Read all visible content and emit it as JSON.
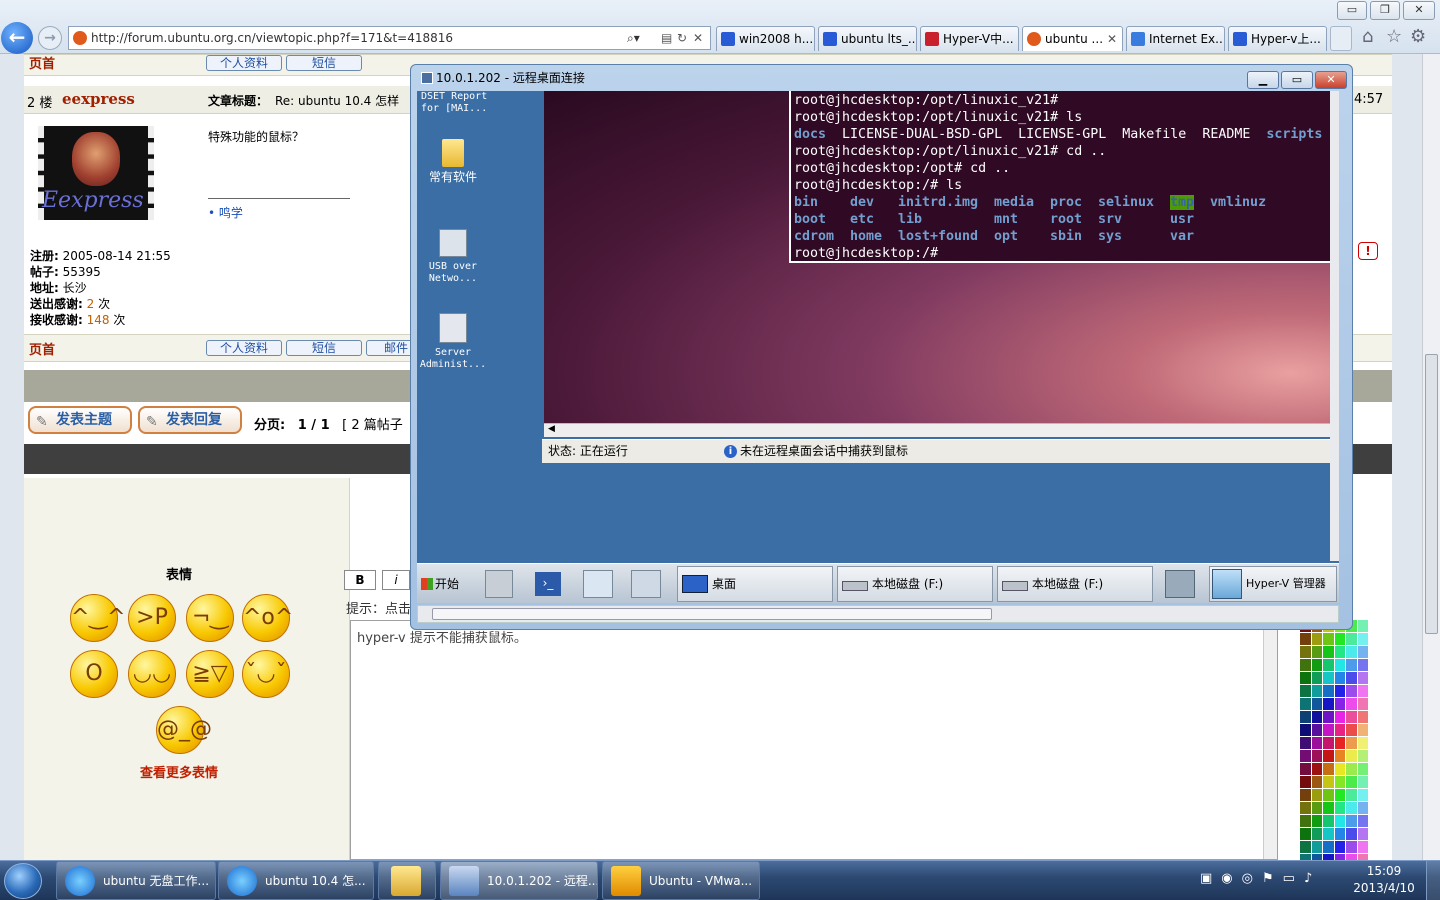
{
  "browser": {
    "url": "http://forum.ubuntu.org.cn/viewtopic.php?f=171&t=418816",
    "tabs": [
      {
        "label": "win2008 h...",
        "color": "#2a5bd7"
      },
      {
        "label": "ubuntu lts_...",
        "color": "#2a5bd7"
      },
      {
        "label": "Hyper-V中...",
        "color": "#c8202c"
      },
      {
        "label": "ubuntu ...",
        "color": "#e05a1c",
        "close": "✕"
      },
      {
        "label": "Internet Ex...",
        "color": "#3a7be0"
      },
      {
        "label": "Hyper-v上...",
        "color": "#2a5bd7"
      }
    ],
    "window_buttons": {
      "minimize": "▭",
      "maximize": "❐",
      "close": "✕"
    }
  },
  "forum": {
    "top_link": "页首",
    "post_number": "2 楼",
    "username": "eexpress",
    "avatar_text": "Eexpress",
    "subject_label": "文章标题：",
    "subject_text": "Re: ubuntu 10.4 怎样",
    "post_body": "特殊功能的鼠标？",
    "signature_link": "鸣学",
    "time_partial": "4:57",
    "profile_buttons": {
      "profile": "个人资料",
      "pm": "短信",
      "email": "邮件"
    },
    "user_info": [
      {
        "label": "注册:",
        "value": "2005-08-14 21:55"
      },
      {
        "label": "帖子:",
        "value": "55395"
      },
      {
        "label": "地址:",
        "value": "长沙"
      },
      {
        "label": "送出感谢:",
        "value": "2",
        "unit": "次"
      },
      {
        "label": "接收感谢:",
        "value": "148",
        "unit": "次"
      }
    ],
    "new_topic": "发表主题",
    "reply": "发表回复",
    "pagination_label": "分页:",
    "pagination_value": "1 / 1",
    "post_count": "[ 2 篇帖子"
  },
  "reply_box": {
    "emoticons_title": "表情",
    "more_emoticons": "查看更多表情",
    "bold": "B",
    "italic": "i",
    "hint": "提示：点击",
    "text": "hyper-v 提示不能捕获鼠标。"
  },
  "rdp": {
    "title": "10.0.1.202 - 远程桌面连接",
    "desktop_icons": [
      {
        "label": "DSET Report for [MAI..."
      },
      {
        "label": "常有软件"
      },
      {
        "label": "USB over Netwo..."
      },
      {
        "label": "Server Administ..."
      }
    ],
    "terminal_lines": [
      "root@jhcdesktop:/opt/linuxic_v21#",
      "root@jhcdesktop:/opt/linuxic_v21# ls"
    ],
    "ls1": [
      "docs",
      "LICENSE-DUAL-BSD-GPL",
      "LICENSE-GPL",
      "Makefile",
      "README",
      "scripts"
    ],
    "terminal_lines2": [
      "root@jhcdesktop:/opt/linuxic_v21# cd ..",
      "root@jhcdesktop:/opt# cd ..",
      "root@jhcdesktop:/# ls"
    ],
    "ls2": [
      [
        "bin",
        "dev",
        "initrd.img",
        "media",
        "proc",
        "selinux",
        "tmp",
        "vmlinuz"
      ],
      [
        "boot",
        "etc",
        "lib",
        "mnt",
        "root",
        "srv",
        "usr"
      ],
      [
        "cdrom",
        "home",
        "lost+found",
        "opt",
        "sbin",
        "sys",
        "var"
      ]
    ],
    "prompt": "root@jhcdesktop:/#",
    "status_label": "状态:",
    "status_value": "正在运行",
    "status_note": "未在远程桌面会话中捕获到鼠标",
    "start": "开始",
    "taskbar_items": [
      "桌面",
      "本地磁盘 (F:)",
      "本地磁盘 (F:)",
      "Hyper-V 管理器"
    ]
  },
  "taskbar": {
    "items": [
      {
        "label": "ubuntu 无盘工作..."
      },
      {
        "label": "ubuntu 10.4 怎..."
      },
      {
        "label": ""
      },
      {
        "label": "10.0.1.202 - 远程..."
      },
      {
        "label": "Ubuntu - VMwa..."
      }
    ],
    "time": "15:09",
    "date": "2013/4/10"
  }
}
